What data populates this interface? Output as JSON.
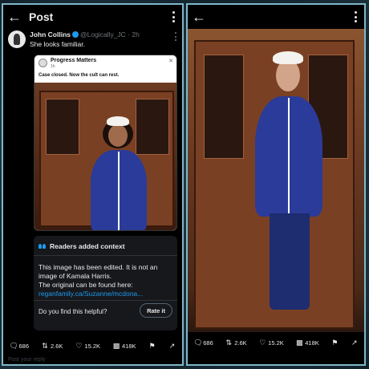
{
  "left": {
    "header": {
      "title": "Post"
    },
    "tweet": {
      "name": "John Collins",
      "handle": "@Logically_JC",
      "time": "· 2h",
      "text": "She looks familiar."
    },
    "quote": {
      "name": "Progress Matters",
      "time": "1h",
      "text": "Case closed. Now the cult can rest."
    },
    "context": {
      "title": "Readers added context",
      "body_line1": "This image has been edited. It is not an",
      "body_line2": "image of Kamala Harris.",
      "body_line3": "The original can be found here:",
      "link": "reganfamily.ca/Suzanne/mcdona...",
      "helpful": "Do you find this helpful?",
      "rate_label": "Rate it"
    },
    "actions": {
      "replies": "686",
      "reposts": "2.6K",
      "likes": "15.2K",
      "views": "418K"
    },
    "reply_placeholder": "Post your reply"
  },
  "right": {
    "actions": {
      "replies": "686",
      "reposts": "2.6K",
      "likes": "15.2K",
      "views": "418K"
    }
  },
  "icons": {
    "back": "back-arrow-icon",
    "menu": "more-vertical-icon",
    "reply": "comment-icon",
    "repost": "repost-icon",
    "like": "heart-icon",
    "views": "bar-chart-icon",
    "bookmark": "bookmark-icon",
    "share": "share-icon"
  },
  "colors": {
    "accent": "#1d9bf0",
    "frame": "#7fb8c8",
    "background": "#000000"
  }
}
